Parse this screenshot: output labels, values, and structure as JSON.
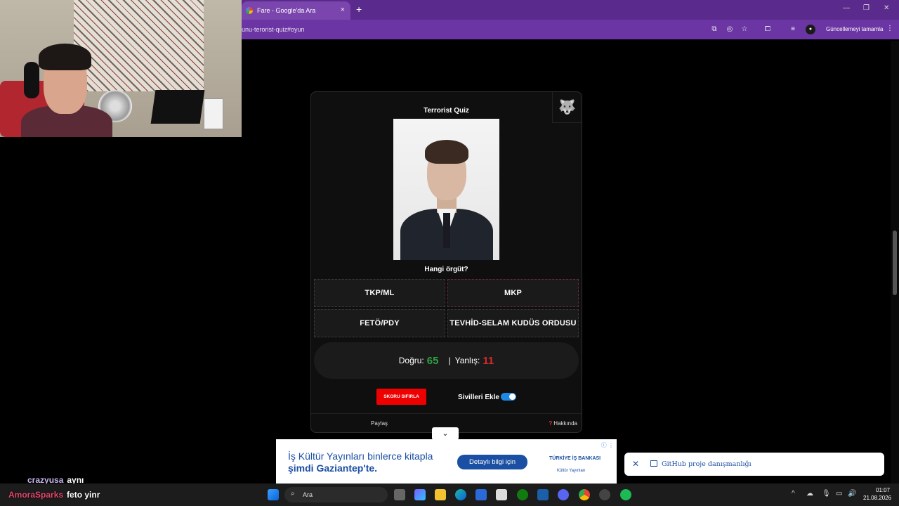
{
  "browser": {
    "tab_title": "Fare - Google'da Ara",
    "tab_close": "×",
    "new_tab": "+",
    "url": "unu-terorist-quiz#oyun",
    "update_label": "Güncellemeyi tamamla",
    "win_min": "—",
    "win_max": "❐",
    "win_close": "✕",
    "kebab": "⋮"
  },
  "quiz": {
    "title": "Terrorist Quiz",
    "question": "Hangi örgüt?",
    "answers": [
      "TKP/ML",
      "MKP",
      "FETÖ/PDY",
      "TEVHİD-SELAM KUDÜS ORDUSU"
    ],
    "correct_label": "Doğru:",
    "correct_count": "65",
    "separator": "|",
    "wrong_label": "Yanlış:",
    "wrong_count": "11",
    "reset_label": "SKORU SIFIRLA",
    "civilians_label": "Sivilleri Ekle",
    "civilians_enabled": true,
    "share_label": "Paylaş",
    "about_q": "?",
    "about_label": "Hakkında"
  },
  "ad": {
    "line1": "İş Kültür Yayınları binlerce kitapla",
    "line2": "şimdi Gaziantep'te.",
    "button": "Detaylı bilgi için",
    "logo_line1": "TÜRKİYE İŞ BANKASI",
    "logo_line2": "Kültür Yayınları",
    "info": "ⓘ ⋮"
  },
  "notification": {
    "close": "✕",
    "text": "GitHub proje danışmanlığı"
  },
  "chat": [
    {
      "user": "crazyusa",
      "message": "aynı"
    },
    {
      "user": "AmoraSparks",
      "message": "feto yinr"
    }
  ],
  "taskbar": {
    "search_placeholder": "Ara",
    "time": "01:07",
    "date": "21.08.2026"
  },
  "colors": {
    "browser_frame": "#5a2a8c",
    "correct": "#2ea043",
    "wrong": "#d32a2a",
    "reset": "#ee0000",
    "toggle": "#1e88e5",
    "ad_blue": "#1a4fa3"
  }
}
